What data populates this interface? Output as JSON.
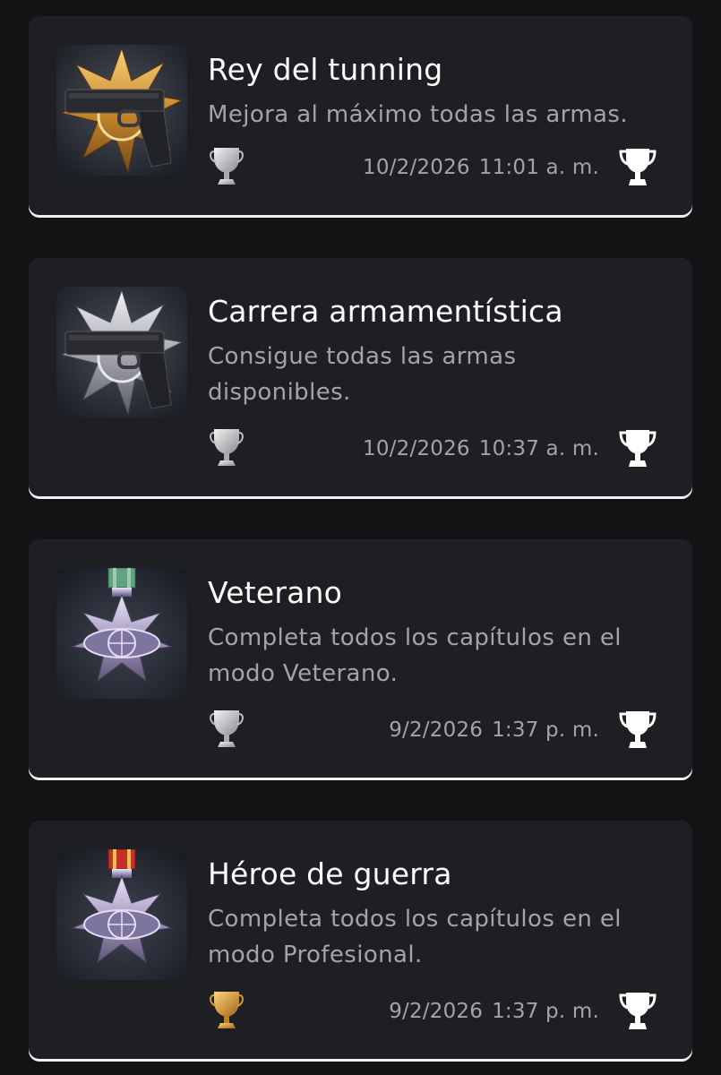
{
  "trophies": [
    {
      "title": "Rey del tunning",
      "description": "Mejora al máximo todas las armas.",
      "date": "10/2/2026",
      "time": "11:01 a. m.",
      "grade": "silver",
      "image_icon": "gold-medal-pistol-icon"
    },
    {
      "title": "Carrera armamentística",
      "description": "Consigue todas las armas disponibles.",
      "date": "10/2/2026",
      "time": "10:37 a. m.",
      "grade": "silver",
      "image_icon": "silver-medal-pistol-icon"
    },
    {
      "title": "Veterano",
      "description": "Completa todos los capítulos en el modo Veterano.",
      "date": "9/2/2026",
      "time": "1:37 p. m.",
      "grade": "silver",
      "image_icon": "bsaa-medal-green-ribbon-icon"
    },
    {
      "title": "Héroe de guerra",
      "description": "Completa todos los capítulos en el modo Profesional.",
      "date": "9/2/2026",
      "time": "1:37 p. m.",
      "grade": "gold",
      "image_icon": "bsaa-medal-red-ribbon-icon"
    }
  ],
  "colors": {
    "background": "#121315",
    "card": "#1e1f22",
    "text_primary": "#ffffff",
    "text_secondary": "#a3a4a8",
    "silver": "#c8c8cc",
    "gold": "#d79a28"
  }
}
